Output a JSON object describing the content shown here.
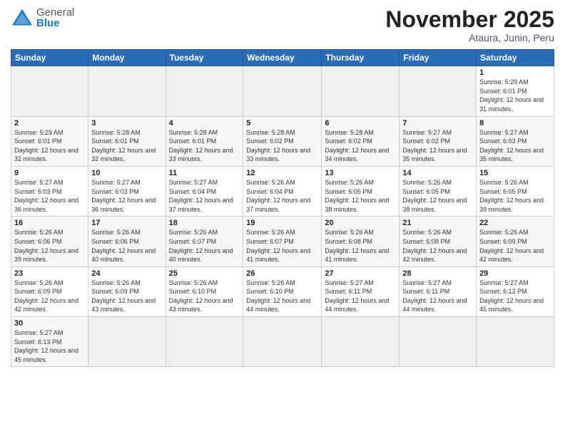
{
  "header": {
    "logo": {
      "general": "General",
      "blue": "Blue"
    },
    "title": "November 2025",
    "location": "Ataura, Junin, Peru"
  },
  "weekdays": [
    "Sunday",
    "Monday",
    "Tuesday",
    "Wednesday",
    "Thursday",
    "Friday",
    "Saturday"
  ],
  "weeks": [
    [
      {
        "day": "",
        "info": ""
      },
      {
        "day": "",
        "info": ""
      },
      {
        "day": "",
        "info": ""
      },
      {
        "day": "",
        "info": ""
      },
      {
        "day": "",
        "info": ""
      },
      {
        "day": "",
        "info": ""
      },
      {
        "day": "1",
        "info": "Sunrise: 5:29 AM\nSunset: 6:01 PM\nDaylight: 12 hours\nand 31 minutes."
      }
    ],
    [
      {
        "day": "2",
        "info": "Sunrise: 5:29 AM\nSunset: 6:01 PM\nDaylight: 12 hours\nand 32 minutes."
      },
      {
        "day": "3",
        "info": "Sunrise: 5:28 AM\nSunset: 6:01 PM\nDaylight: 12 hours\nand 32 minutes."
      },
      {
        "day": "4",
        "info": "Sunrise: 5:28 AM\nSunset: 6:01 PM\nDaylight: 12 hours\nand 33 minutes."
      },
      {
        "day": "5",
        "info": "Sunrise: 5:28 AM\nSunset: 6:02 PM\nDaylight: 12 hours\nand 33 minutes."
      },
      {
        "day": "6",
        "info": "Sunrise: 5:28 AM\nSunset: 6:02 PM\nDaylight: 12 hours\nand 34 minutes."
      },
      {
        "day": "7",
        "info": "Sunrise: 5:27 AM\nSunset: 6:02 PM\nDaylight: 12 hours\nand 35 minutes."
      },
      {
        "day": "8",
        "info": "Sunrise: 5:27 AM\nSunset: 6:03 PM\nDaylight: 12 hours\nand 35 minutes."
      }
    ],
    [
      {
        "day": "9",
        "info": "Sunrise: 5:27 AM\nSunset: 6:03 PM\nDaylight: 12 hours\nand 36 minutes."
      },
      {
        "day": "10",
        "info": "Sunrise: 5:27 AM\nSunset: 6:03 PM\nDaylight: 12 hours\nand 36 minutes."
      },
      {
        "day": "11",
        "info": "Sunrise: 5:27 AM\nSunset: 6:04 PM\nDaylight: 12 hours\nand 37 minutes."
      },
      {
        "day": "12",
        "info": "Sunrise: 5:26 AM\nSunset: 6:04 PM\nDaylight: 12 hours\nand 37 minutes."
      },
      {
        "day": "13",
        "info": "Sunrise: 5:26 AM\nSunset: 6:05 PM\nDaylight: 12 hours\nand 38 minutes."
      },
      {
        "day": "14",
        "info": "Sunrise: 5:26 AM\nSunset: 6:05 PM\nDaylight: 12 hours\nand 38 minutes."
      },
      {
        "day": "15",
        "info": "Sunrise: 5:26 AM\nSunset: 6:05 PM\nDaylight: 12 hours\nand 39 minutes."
      }
    ],
    [
      {
        "day": "16",
        "info": "Sunrise: 5:26 AM\nSunset: 6:06 PM\nDaylight: 12 hours\nand 39 minutes."
      },
      {
        "day": "17",
        "info": "Sunrise: 5:26 AM\nSunset: 6:06 PM\nDaylight: 12 hours\nand 40 minutes."
      },
      {
        "day": "18",
        "info": "Sunrise: 5:26 AM\nSunset: 6:07 PM\nDaylight: 12 hours\nand 40 minutes."
      },
      {
        "day": "19",
        "info": "Sunrise: 5:26 AM\nSunset: 6:07 PM\nDaylight: 12 hours\nand 41 minutes."
      },
      {
        "day": "20",
        "info": "Sunrise: 5:26 AM\nSunset: 6:08 PM\nDaylight: 12 hours\nand 41 minutes."
      },
      {
        "day": "21",
        "info": "Sunrise: 5:26 AM\nSunset: 6:08 PM\nDaylight: 12 hours\nand 42 minutes."
      },
      {
        "day": "22",
        "info": "Sunrise: 5:26 AM\nSunset: 6:09 PM\nDaylight: 12 hours\nand 42 minutes."
      }
    ],
    [
      {
        "day": "23",
        "info": "Sunrise: 5:26 AM\nSunset: 6:09 PM\nDaylight: 12 hours\nand 42 minutes."
      },
      {
        "day": "24",
        "info": "Sunrise: 5:26 AM\nSunset: 6:09 PM\nDaylight: 12 hours\nand 43 minutes."
      },
      {
        "day": "25",
        "info": "Sunrise: 5:26 AM\nSunset: 6:10 PM\nDaylight: 12 hours\nand 43 minutes."
      },
      {
        "day": "26",
        "info": "Sunrise: 5:26 AM\nSunset: 6:10 PM\nDaylight: 12 hours\nand 44 minutes."
      },
      {
        "day": "27",
        "info": "Sunrise: 5:27 AM\nSunset: 6:11 PM\nDaylight: 12 hours\nand 44 minutes."
      },
      {
        "day": "28",
        "info": "Sunrise: 5:27 AM\nSunset: 6:11 PM\nDaylight: 12 hours\nand 44 minutes."
      },
      {
        "day": "29",
        "info": "Sunrise: 5:27 AM\nSunset: 6:12 PM\nDaylight: 12 hours\nand 45 minutes."
      }
    ],
    [
      {
        "day": "30",
        "info": "Sunrise: 5:27 AM\nSunset: 6:13 PM\nDaylight: 12 hours\nand 45 minutes."
      },
      {
        "day": "",
        "info": ""
      },
      {
        "day": "",
        "info": ""
      },
      {
        "day": "",
        "info": ""
      },
      {
        "day": "",
        "info": ""
      },
      {
        "day": "",
        "info": ""
      },
      {
        "day": "",
        "info": ""
      }
    ]
  ]
}
